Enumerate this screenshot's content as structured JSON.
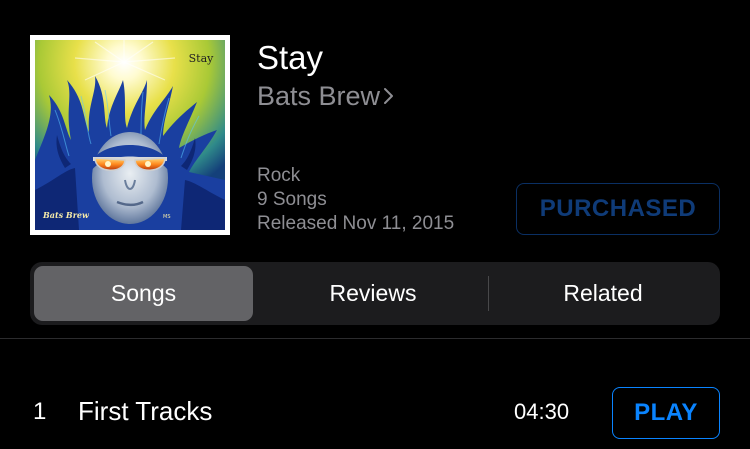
{
  "album": {
    "title": "Stay",
    "artist": "Bats Brew",
    "genre": "Rock",
    "song_count": "9 Songs",
    "released": "Released Nov 11, 2015",
    "purchase_label": "PURCHASED",
    "cover": {
      "title_text": "Stay",
      "artist_text": "Bats Brew",
      "corner_mark": "MS"
    }
  },
  "tabs": [
    {
      "label": "Songs",
      "selected": true
    },
    {
      "label": "Reviews",
      "selected": false
    },
    {
      "label": "Related",
      "selected": false
    }
  ],
  "tracks": [
    {
      "number": "1",
      "title": "First Tracks",
      "duration": "04:30",
      "action": "PLAY"
    }
  ],
  "colors": {
    "background": "#000000",
    "secondary_text": "#8e8e93",
    "accent": "#0a84ff",
    "purchased_disabled": "#0f3b78",
    "segment_bg": "#1c1c1e",
    "segment_selected": "#636366"
  },
  "icons": {
    "artist_chevron": "chevron-right-icon"
  }
}
